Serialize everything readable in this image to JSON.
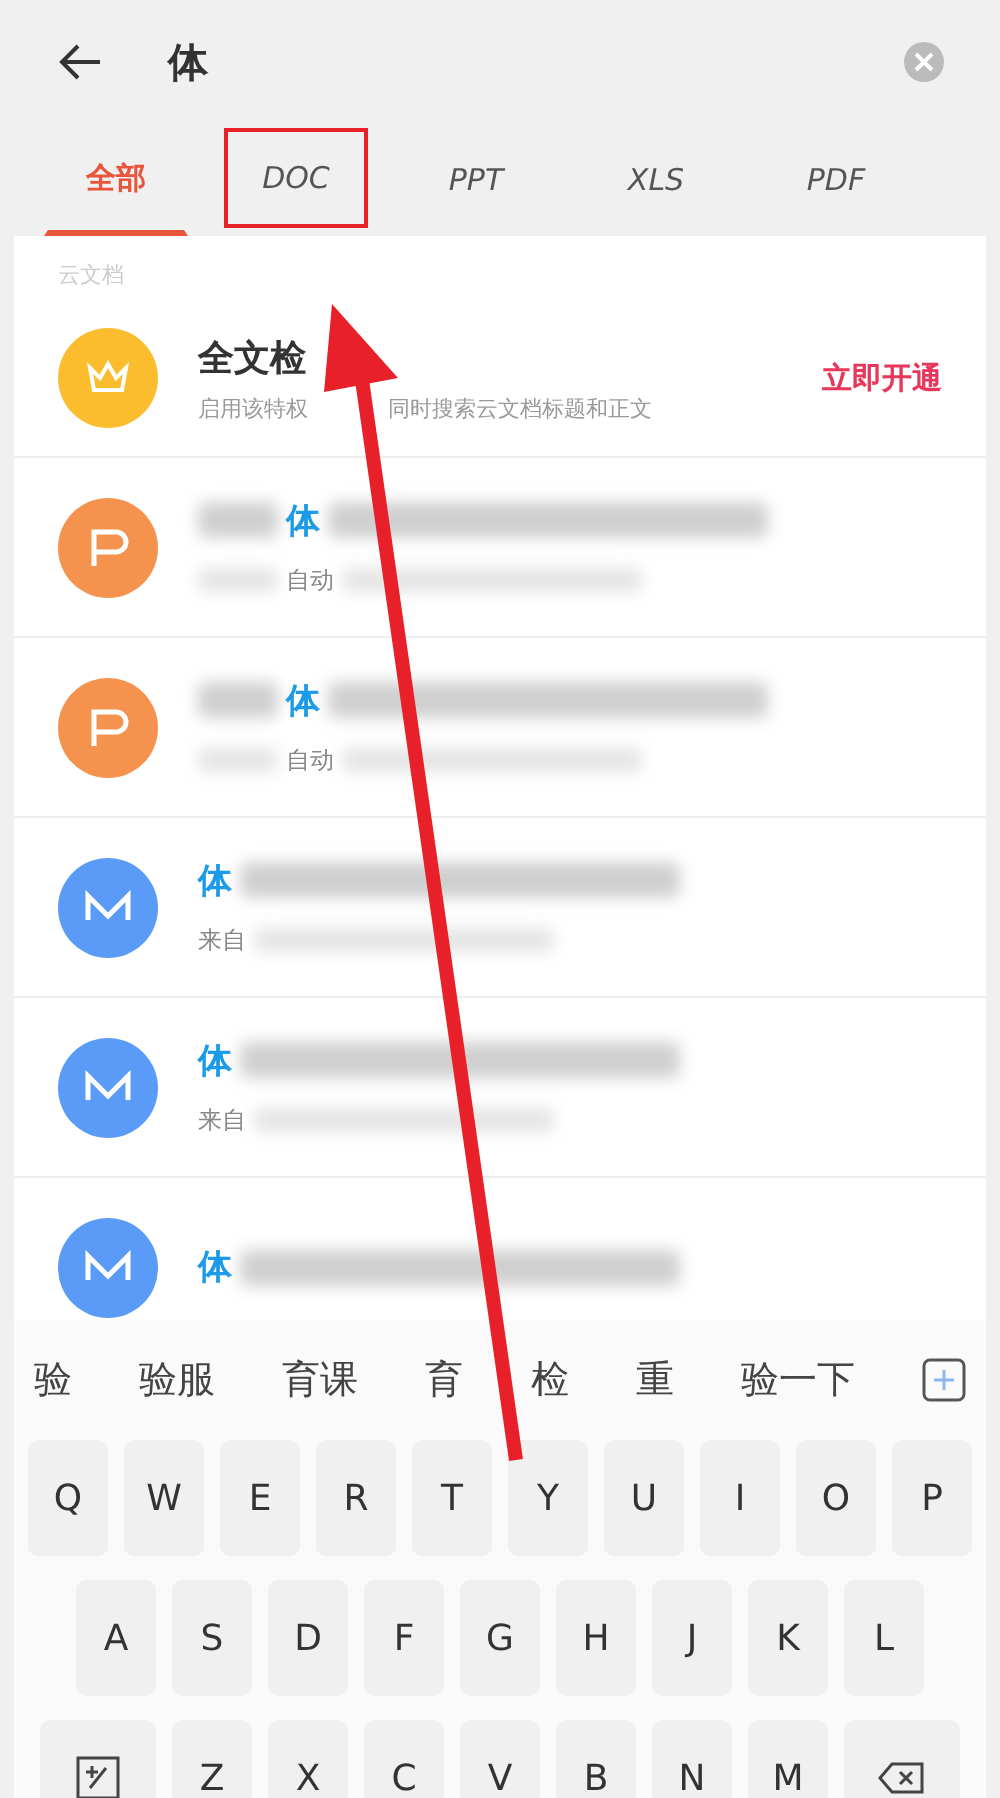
{
  "search": {
    "value": "体"
  },
  "tabs": [
    {
      "label": "全部",
      "selected": true,
      "highlighted": false
    },
    {
      "label": "DOC",
      "selected": false,
      "highlighted": true
    },
    {
      "label": "PPT",
      "selected": false,
      "highlighted": false
    },
    {
      "label": "XLS",
      "selected": false,
      "highlighted": false
    },
    {
      "label": "PDF",
      "selected": false,
      "highlighted": false
    }
  ],
  "section_label": "云文档",
  "promo": {
    "title": "全文检",
    "subtitle": [
      "启用该特权",
      "同时搜索云文档标题和正文"
    ],
    "action": "立即开通"
  },
  "results": [
    {
      "kind": "ppt",
      "match": "体",
      "source": "自动"
    },
    {
      "kind": "ppt",
      "match": "体",
      "source": "自动"
    },
    {
      "kind": "word",
      "match": "体",
      "source": "来自"
    },
    {
      "kind": "word",
      "match": "体",
      "source": "来自"
    },
    {
      "kind": "word",
      "match": "体"
    }
  ],
  "candidates": [
    "验",
    "验服",
    "育课",
    "育",
    "检",
    "重",
    "验一下"
  ],
  "keyboard": {
    "rows": [
      [
        "Q",
        "W",
        "E",
        "R",
        "T",
        "Y",
        "U",
        "I",
        "O",
        "P"
      ],
      [
        "A",
        "S",
        "D",
        "F",
        "G",
        "H",
        "J",
        "K",
        "L"
      ],
      [
        "Z",
        "X",
        "C",
        "V",
        "B",
        "N",
        "M"
      ]
    ]
  }
}
